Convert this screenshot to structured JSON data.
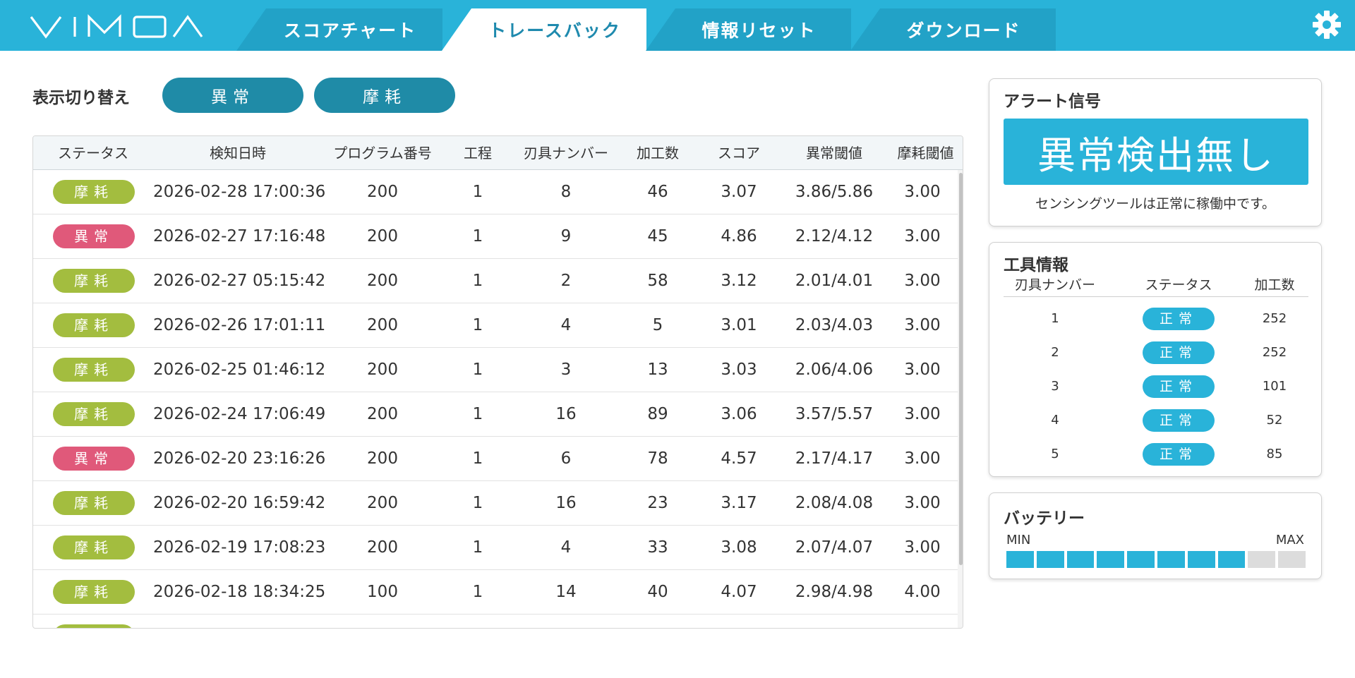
{
  "app": {
    "logo_text": "VIMOA"
  },
  "nav": {
    "tabs": [
      {
        "label": "スコアチャート"
      },
      {
        "label": "トレースバック"
      },
      {
        "label": "情報リセット"
      },
      {
        "label": "ダウンロード"
      }
    ],
    "active_tab": "トレースバック",
    "settings_icon": "gear-icon"
  },
  "view_toggle": {
    "label": "表示切り替え",
    "buttons": [
      {
        "label": "異常"
      },
      {
        "label": "摩耗"
      }
    ]
  },
  "colors": {
    "header": "#29b3d9",
    "wear_badge": "#a3bd3f",
    "anomaly_badge": "#e0597a",
    "normal_badge": "#29b3d9",
    "toggle_button": "#1f8ba7"
  },
  "table": {
    "columns": [
      "ステータス",
      "検知日時",
      "プログラム番号",
      "工程",
      "刃具ナンバー",
      "加工数",
      "スコア",
      "異常閾値",
      "摩耗閾値"
    ],
    "rows": [
      {
        "status": "摩耗",
        "type": "wear",
        "datetime": "2026-02-28 17:00:36",
        "program": "200",
        "process": "1",
        "tool": "8",
        "count": "46",
        "score": "3.07",
        "anomaly_th": "3.86/5.86",
        "wear_th": "3.00"
      },
      {
        "status": "異常",
        "type": "anomaly",
        "datetime": "2026-02-27 17:16:48",
        "program": "200",
        "process": "1",
        "tool": "9",
        "count": "45",
        "score": "4.86",
        "anomaly_th": "2.12/4.12",
        "wear_th": "3.00"
      },
      {
        "status": "摩耗",
        "type": "wear",
        "datetime": "2026-02-27 05:15:42",
        "program": "200",
        "process": "1",
        "tool": "2",
        "count": "58",
        "score": "3.12",
        "anomaly_th": "2.01/4.01",
        "wear_th": "3.00"
      },
      {
        "status": "摩耗",
        "type": "wear",
        "datetime": "2026-02-26 17:01:11",
        "program": "200",
        "process": "1",
        "tool": "4",
        "count": "5",
        "score": "3.01",
        "anomaly_th": "2.03/4.03",
        "wear_th": "3.00"
      },
      {
        "status": "摩耗",
        "type": "wear",
        "datetime": "2026-02-25 01:46:12",
        "program": "200",
        "process": "1",
        "tool": "3",
        "count": "13",
        "score": "3.03",
        "anomaly_th": "2.06/4.06",
        "wear_th": "3.00"
      },
      {
        "status": "摩耗",
        "type": "wear",
        "datetime": "2026-02-24 17:06:49",
        "program": "200",
        "process": "1",
        "tool": "16",
        "count": "89",
        "score": "3.06",
        "anomaly_th": "3.57/5.57",
        "wear_th": "3.00"
      },
      {
        "status": "異常",
        "type": "anomaly",
        "datetime": "2026-02-20 23:16:26",
        "program": "200",
        "process": "1",
        "tool": "6",
        "count": "78",
        "score": "4.57",
        "anomaly_th": "2.17/4.17",
        "wear_th": "3.00"
      },
      {
        "status": "摩耗",
        "type": "wear",
        "datetime": "2026-02-20 16:59:42",
        "program": "200",
        "process": "1",
        "tool": "16",
        "count": "23",
        "score": "3.17",
        "anomaly_th": "2.08/4.08",
        "wear_th": "3.00"
      },
      {
        "status": "摩耗",
        "type": "wear",
        "datetime": "2026-02-19 17:08:23",
        "program": "200",
        "process": "1",
        "tool": "4",
        "count": "33",
        "score": "3.08",
        "anomaly_th": "2.07/4.07",
        "wear_th": "3.00"
      },
      {
        "status": "摩耗",
        "type": "wear",
        "datetime": "2026-02-18 18:34:25",
        "program": "100",
        "process": "1",
        "tool": "14",
        "count": "40",
        "score": "4.07",
        "anomaly_th": "2.98/4.98",
        "wear_th": "4.00"
      },
      {
        "status": "摩耗",
        "type": "wear",
        "datetime": "",
        "program": "",
        "process": "",
        "tool": "",
        "count": "",
        "score": "",
        "anomaly_th": "",
        "wear_th": ""
      }
    ]
  },
  "alert": {
    "title": "アラート信号",
    "status": "異常検出無し",
    "message": "センシングツールは正常に稼働中です。"
  },
  "tools": {
    "title": "工具情報",
    "columns": [
      "刃具ナンバー",
      "ステータス",
      "加工数"
    ],
    "rows": [
      {
        "number": "1",
        "status": "正常",
        "count": "252"
      },
      {
        "number": "2",
        "status": "正常",
        "count": "252"
      },
      {
        "number": "3",
        "status": "正常",
        "count": "101"
      },
      {
        "number": "4",
        "status": "正常",
        "count": "52"
      },
      {
        "number": "5",
        "status": "正常",
        "count": "85"
      }
    ]
  },
  "battery": {
    "title": "バッテリー",
    "min_label": "MIN",
    "max_label": "MAX",
    "segments_total": 10,
    "segments_filled": 8
  }
}
